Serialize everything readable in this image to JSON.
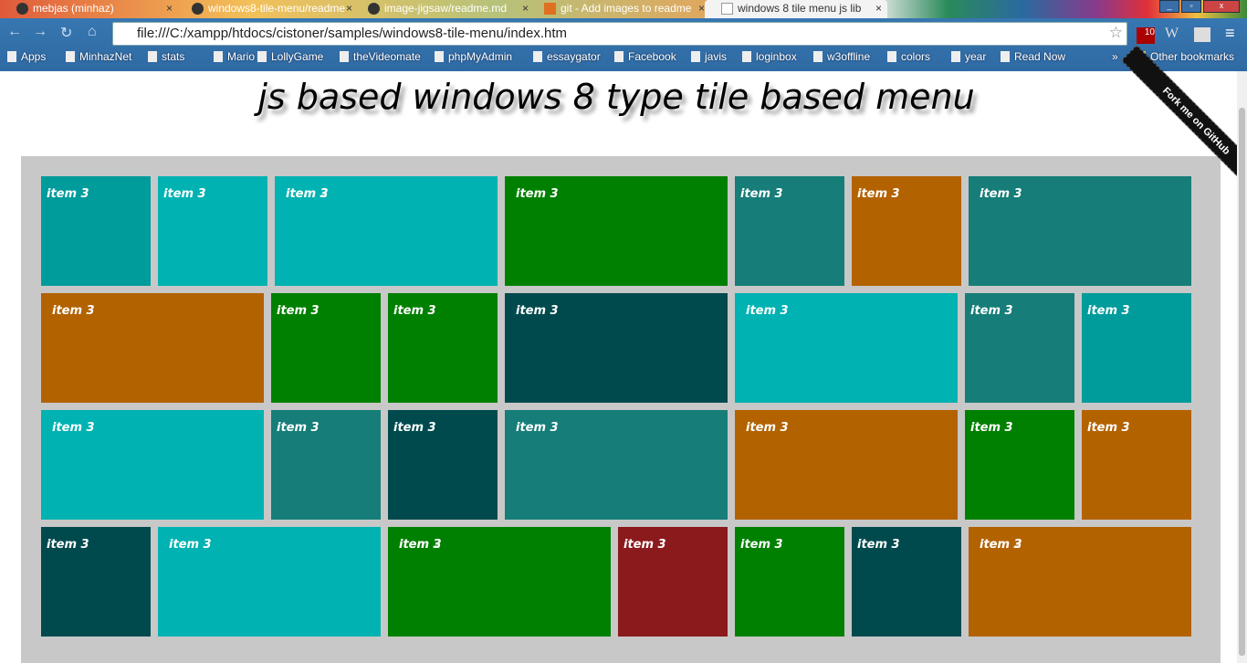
{
  "browser": {
    "tabs": [
      {
        "title": "mebjas (minhaz)"
      },
      {
        "title": "windows8-tile-menu/readme"
      },
      {
        "title": "image-jigsaw/readme.md"
      },
      {
        "title": "git - Add images to readme"
      },
      {
        "title": "windows 8 tile menu js lib",
        "active": true
      }
    ],
    "url": "file:///C:/xampp/htdocs/cistoner/samples/windows8-tile-menu/index.htm",
    "extension_badge": "10",
    "bookmarks": [
      "Apps",
      "MinhazNet",
      "stats",
      "Mario",
      "LollyGame",
      "theVideomate",
      "phpMyAdmin",
      "essaygator",
      "Facebook",
      "javis",
      "loginbox",
      "w3offline",
      "colors",
      "year",
      "Read Now"
    ],
    "other_bookmarks": "Other bookmarks"
  },
  "page": {
    "title": "js based windows 8 type tile based menu",
    "ribbon": "Fork me on GitHub",
    "colors": {
      "cyan": "#009b9b",
      "light_cyan": "#00b2b2",
      "green": "#008000",
      "teal": "#167d78",
      "orange": "#b36200",
      "dark": "#004a4e",
      "red": "#8b1a1d"
    },
    "tiles": [
      [
        {
          "label": "item 3",
          "color": "cyan"
        },
        {
          "label": "item 3",
          "color": "light_cyan"
        },
        {
          "label": "item 3",
          "overlap": "item 2",
          "color": "light_cyan"
        },
        {
          "label": "item 3",
          "color": "green"
        },
        {
          "label": "item 3",
          "color": "teal"
        },
        {
          "label": "item 3",
          "color": "orange"
        },
        {
          "label": "item 3",
          "color": "teal"
        }
      ],
      [
        {
          "label": "item 3",
          "color": "orange"
        },
        {
          "label": "item 3",
          "color": "green"
        },
        {
          "label": "item 3",
          "color": "green"
        },
        {
          "label": "item 3",
          "color": "dark"
        },
        {
          "label": "item 3",
          "color": "light_cyan"
        },
        {
          "label": "item 3",
          "color": "teal"
        },
        {
          "label": "item 3",
          "color": "cyan"
        }
      ],
      [
        {
          "label": "item 3",
          "color": "light_cyan"
        },
        {
          "label": "item 3",
          "color": "teal"
        },
        {
          "label": "item 3",
          "color": "dark"
        },
        {
          "label": "item 3",
          "color": "teal"
        },
        {
          "label": "item 3",
          "color": "orange"
        },
        {
          "label": "item 3",
          "color": "green"
        },
        {
          "label": "item 3",
          "color": "orange"
        }
      ],
      [
        {
          "label": "item 3",
          "color": "dark"
        },
        {
          "label": "item 3",
          "color": "light_cyan"
        },
        {
          "label": "item 3",
          "overlap": "item 2",
          "color": "green"
        },
        {
          "label": "item 3",
          "color": "red"
        },
        {
          "label": "item 3",
          "color": "green"
        },
        {
          "label": "item 3",
          "color": "dark"
        },
        {
          "label": "item 3",
          "overlap": "item 2",
          "color": "orange"
        }
      ]
    ]
  }
}
